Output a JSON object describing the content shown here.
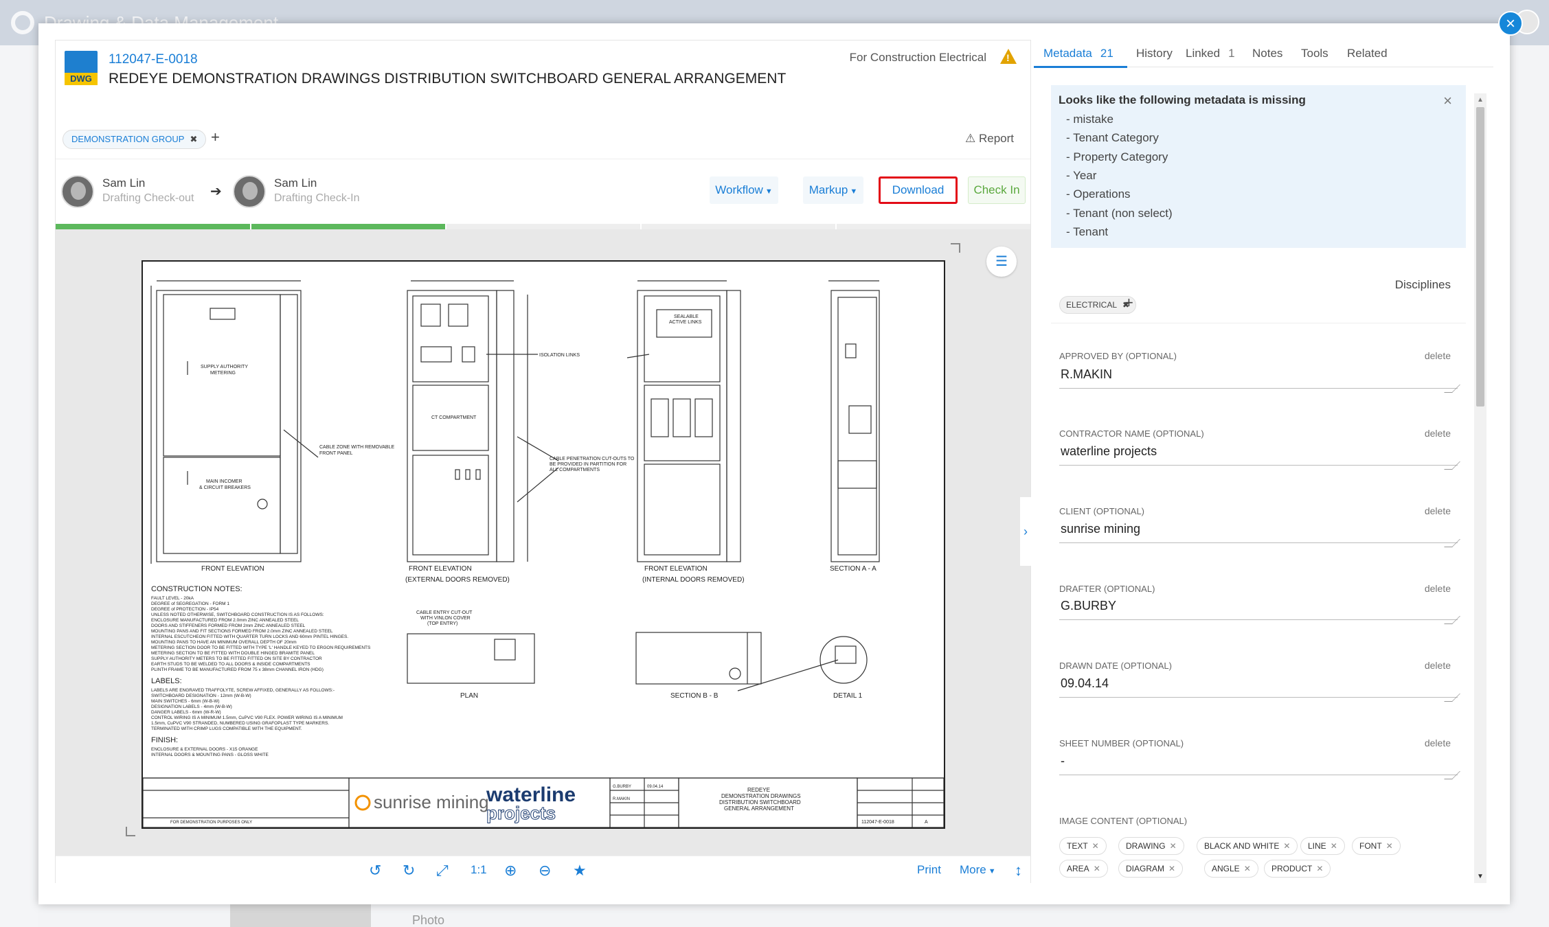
{
  "app": {
    "title": "Drawing & Data Management"
  },
  "background": {
    "bottom_text": "Photo"
  },
  "document": {
    "type_badge": "DWG",
    "number": "112047-E-0018",
    "title": "REDEYE DEMONSTRATION DRAWINGS DISTRIBUTION SWITCHBOARD GENERAL ARRANGEMENT",
    "status": "For Construction Electrical",
    "group_tag": "DEMONSTRATION GROUP",
    "report_label": "Report"
  },
  "workflow_people": [
    {
      "name": "Sam Lin",
      "role": "Drafting Check-out"
    },
    {
      "name": "Sam Lin",
      "role": "Drafting Check-In"
    }
  ],
  "actions": {
    "workflow": "Workflow",
    "markup": "Markup",
    "download": "Download",
    "checkin": "Check In"
  },
  "progress": {
    "completed_steps": 2,
    "total_steps": 5
  },
  "toolbar": {
    "zoom_label": "1:1",
    "print": "Print",
    "more": "More"
  },
  "drawing": {
    "labels": {
      "front_elevation": "FRONT ELEVATION",
      "front_elevation_ext": "FRONT ELEVATION",
      "ext_doors": "(EXTERNAL DOORS REMOVED)",
      "front_elevation_int": "FRONT ELEVATION",
      "int_doors": "(INTERNAL DOORS REMOVED)",
      "section_aa": "SECTION A - A",
      "plan": "PLAN",
      "section_bb": "SECTION B - B",
      "detail1": "DETAIL 1",
      "construction_notes": "CONSTRUCTION NOTES:",
      "labels_heading": "LABELS:",
      "finish_heading": "FINISH:",
      "supply": "SUPPLY AUTHORITY",
      "metering": "METERING",
      "main_incomer": "MAIN INCOMER",
      "circuit_breakers": "& CIRCUIT BREAKERS",
      "cable_zone": "CABLE ZONE WITH REMOVABLE",
      "front_panel": "FRONT PANEL",
      "isolation_links": "ISOLATION LINKS",
      "ct_compartment": "CT COMPARTMENT",
      "sealable": "SEALABLE",
      "active_links": "ACTIVE LINKS",
      "cable_penetration": "CABLE PENETRATION CUT-OUTS TO",
      "partition": "BE PROVIDED IN PARTITION FOR",
      "all_compartments": "ALL COMPARTMENTS",
      "cable_entry": "CABLE ENTRY CUT-OUT",
      "vinlon": "WITH VINLON COVER",
      "top_entry": "(TOP ENTRY)",
      "client_logo": "sunrise mining",
      "contractor_logo_1": "waterline",
      "contractor_logo_2": "projects",
      "drawing_title_1": "REDEYE",
      "drawing_title_2": "DEMONSTRATION DRAWINGS",
      "drawing_title_3": "DISTRIBUTION SWITCHBOARD",
      "drawing_title_4": "GENERAL ARRANGEMENT",
      "drawing_no": "112047-E-0018",
      "revision_note": "FOR DEMONSTRATION PURPOSES ONLY",
      "drawn_by": "G.BURBY",
      "drawn_date": "09.04.14",
      "approved_by": "R.MAKIN",
      "rev": "A"
    },
    "notes": [
      "FAULT LEVEL - 20kA",
      "DEGREE of SEGREGATION - FORM 1",
      "DEGREE of PROTECTION - IP54",
      "UNLESS NOTED OTHERWISE, SWITCHBOARD CONSTRUCTION IS AS FOLLOWS:",
      "ENCLOSURE MANUFACTURED FROM 2.0mm ZINC ANNEALED STEEL",
      "DOORS AND STIFFENERS FORMED FROM 2mm ZINC ANNEALED STEEL",
      "MOUNTING PANS AND FIT SECTIONS FORMED FROM 2.0mm ZINC ANNEALED STEEL",
      "INTERNAL ESCUTCHEON FITTED WITH QUARTER TURN LOCKS AND 60mm PINTEL HINGES.",
      "MOUNTING PANS TO HAVE AN MINIMUM OVERALL DEPTH OF 20mm",
      "METERING SECTION DOOR TO BE FITTED WITH TYPE 'L' HANDLE KEYED TO ERGON REQUIREMENTS",
      "METERING SECTION TO BE FITTED WITH DOUBLE HINGED BRAMITE PANEL",
      "SUPPLY AUTHORITY METERS TO BE FITTED FITTED ON SITE BY CONTRACTOR",
      "EARTH STUDS TO BE WELDED TO ALL DOORS & INSIDE COMPARTMENTS",
      "PLINTH FRAME TO BE MANUFACTURED FROM 75 x 38mm CHANNEL IRON (HDG)"
    ],
    "label_notes": [
      "LABELS ARE ENGRAVED TRAFFOLYTE, SCREW AFFIXED, GENERALLY AS FOLLOWS:-",
      "SWITCHBOARD DESIGNATION - 12mm (W-B-W)",
      "MAIN SWITCHES - 6mm (W-B-W)",
      "DESIGNATION LABELS - 4mm (W-B-W)",
      "DANGER LABELS - 6mm (W-R-W)",
      "CONTROL WIRING IS A MINIMUM 1.5mm, CuPVC V90 FLEX. POWER WIRING IS A MINIMUM",
      "1.5mm, CuPVC V90 STRANDED, NUMBERED USING GRAFOPLAST TYPE MARKERS.",
      "TERMINATED WITH CRIMP LUGS COMPATIBLE WITH THE EQUIPMENT."
    ],
    "finish_notes": [
      "ENCLOSURE & EXTERNAL DOORS - X15 ORANGE",
      "INTERNAL DOORS & MOUNTING PANS - GLOSS WHITE"
    ]
  },
  "metadata_tabs": [
    {
      "label": "Metadata",
      "count": "21"
    },
    {
      "label": "History",
      "count": ""
    },
    {
      "label": "Linked",
      "count": "1"
    },
    {
      "label": "Notes",
      "count": ""
    },
    {
      "label": "Tools",
      "count": ""
    },
    {
      "label": "Related",
      "count": ""
    }
  ],
  "missing_alert": {
    "title": "Looks like the following metadata is missing",
    "items": [
      "- mistake",
      "- Tenant Category",
      "- Property Category",
      "- Year",
      "- Operations",
      "- Tenant (non select)",
      "- Tenant"
    ]
  },
  "disciplines": {
    "label": "Disciplines",
    "tags": [
      "ELECTRICAL"
    ]
  },
  "fields": [
    {
      "label": "APPROVED BY (OPTIONAL)",
      "value": "R.MAKIN",
      "delete": "delete"
    },
    {
      "label": "CONTRACTOR NAME (OPTIONAL)",
      "value": "waterline projects",
      "delete": "delete"
    },
    {
      "label": "CLIENT (OPTIONAL)",
      "value": "sunrise mining",
      "delete": "delete"
    },
    {
      "label": "DRAFTER (OPTIONAL)",
      "value": "G.BURBY",
      "delete": "delete"
    },
    {
      "label": "DRAWN DATE (OPTIONAL)",
      "value": "09.04.14",
      "delete": "delete"
    },
    {
      "label": "SHEET NUMBER (OPTIONAL)",
      "value": "-",
      "delete": "delete"
    }
  ],
  "image_content": {
    "label": "IMAGE CONTENT (OPTIONAL)",
    "chips": [
      "TEXT",
      "DRAWING",
      "BLACK AND WHITE",
      "LINE",
      "FONT",
      "AREA",
      "DIAGRAM",
      "ANGLE",
      "PRODUCT"
    ]
  },
  "colors": {
    "accent": "#1a7ed6",
    "success": "#5cb85c",
    "danger": "#e30b17",
    "warning": "#e2a300"
  }
}
